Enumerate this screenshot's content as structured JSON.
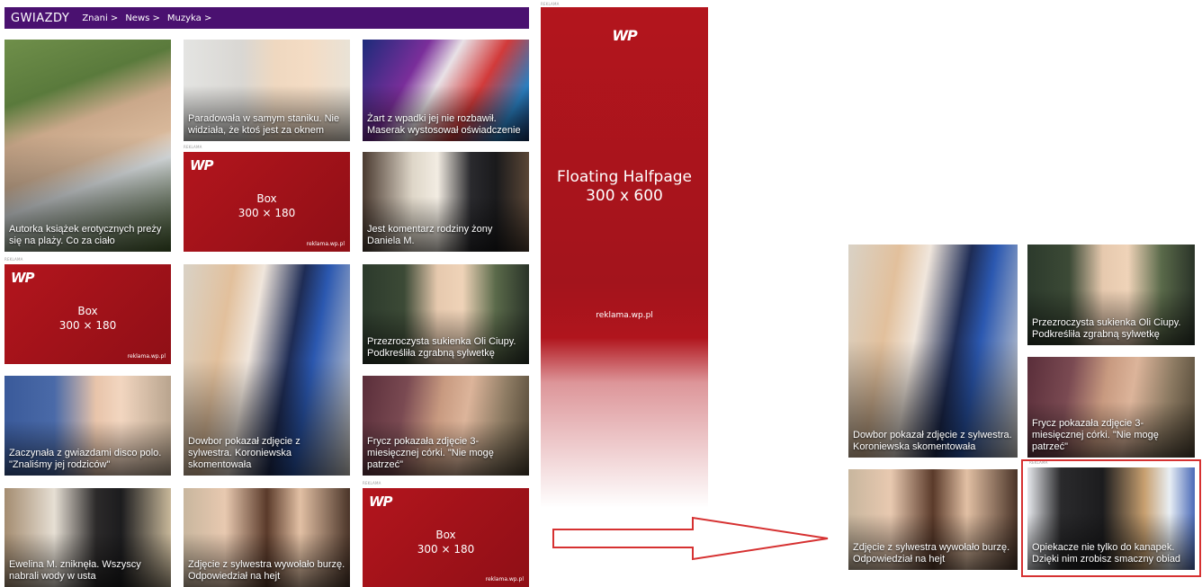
{
  "header": {
    "brand": "GWIAZDY",
    "nav": [
      {
        "label": "Znani >"
      },
      {
        "label": "News >"
      },
      {
        "label": "Muzyka >"
      }
    ]
  },
  "ad_label": "REKLAMA",
  "ads": {
    "logo_text": "WP",
    "box_line1": "Box",
    "box_line2": "300 × 180",
    "site": "reklama.wp.pl",
    "halfpage_line1": "Floating Halfpage",
    "halfpage_line2": "300 x 600"
  },
  "tiles": [
    {
      "caption": "Autorka książek erotycznych preży się na plaży. Co za ciało"
    },
    {
      "caption": "Paradowała w samym staniku. Nie widziała, że ktoś jest za oknem"
    },
    {
      "caption": "Żart z wpadki jej nie rozbawił. Maserak wystosował oświadczenie"
    },
    {
      "caption": "Jest komentarz rodziny żony Daniela M."
    },
    {
      "caption": "Dowbor pokazał zdjęcie z sylwestra. Koroniewska skomentowała"
    },
    {
      "caption": "Przezroczysta sukienka Oli Ciupy. Podkreśliła zgrabną sylwetkę"
    },
    {
      "caption": "Zaczynała z gwiazdami disco polo. \"Znaliśmy jej rodziców\""
    },
    {
      "caption": "Frycz pokazała zdjęcie 3-miesięcznej córki. \"Nie mogę patrzeć\""
    },
    {
      "caption": "Ewelina M. zniknęła. Wszyscy nabrali wody w usta"
    },
    {
      "caption": "Zdjęcie z sylwestra wywołało burzę. Odpowiedział na hejt"
    }
  ],
  "right_panel": [
    {
      "caption": "Dowbor pokazał zdjęcie z sylwestra. Koroniewska skomentowała"
    },
    {
      "caption": "Przezroczysta sukienka Oli Ciupy. Podkreśliła zgrabną sylwetkę"
    },
    {
      "caption": "Frycz pokazała zdjęcie 3-miesięcznej córki. \"Nie mogę patrzeć\""
    },
    {
      "caption": "Zdjęcie z sylwestra wywołało burzę. Odpowiedział na hejt"
    },
    {
      "caption": "Opiekacze nie tylko do kanapek. Dzięki nim zrobisz smaczny obiad"
    }
  ],
  "colors": {
    "nav_bar": "#4a1170",
    "ad_red": "#b3151d",
    "arrow": "#d63131",
    "highlight_border": "#d63131"
  }
}
